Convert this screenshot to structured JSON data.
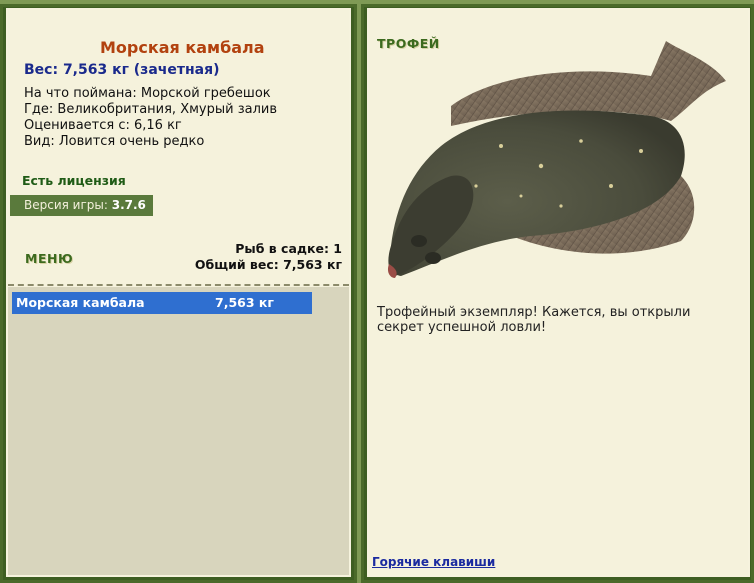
{
  "left_panel": {
    "fish_name": "Морская камбала",
    "weight_line": "Вес: 7,563 кг (зачетная)",
    "info": [
      "На что поймана: Морской гребешок",
      "Где: Великобритания, Хмурый залив",
      "Оценивается с: 6,16 кг",
      "Вид: Ловится очень редко"
    ],
    "license": "Есть лицензия",
    "version_label": "Версия игры:",
    "version_value": "3.7.6",
    "menu_button": "МЕНЮ",
    "fish_in_keepnet": "Рыб в садке: 1",
    "total_weight": "Общий вес: 7,563 кг"
  },
  "catch_list": [
    {
      "name": "Морская камбала",
      "weight": "7,563 кг"
    }
  ],
  "right_panel": {
    "trophy_label": "ТРОФЕЙ",
    "fish_image": "flounder-image",
    "description": "Трофейный экземпляр! Кажется, вы открыли секрет успешной ловли!",
    "hotkeys_link": "Горячие клавиши"
  },
  "colors": {
    "background": "#7f9a55",
    "panel": "#f5f2dc",
    "title": "#b2420f",
    "weight": "#1a2a8c",
    "accent_green": "#3c6a1e",
    "selection": "#2f6fd0"
  }
}
